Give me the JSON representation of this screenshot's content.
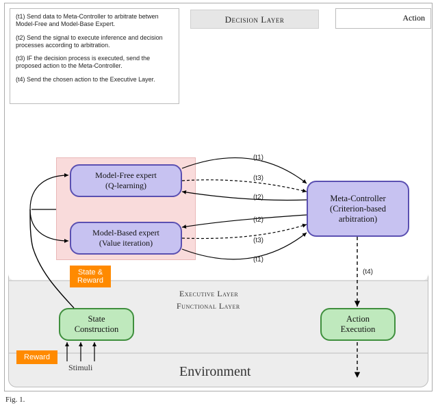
{
  "header": {
    "title": "Decision Layer",
    "action_label": "Action"
  },
  "legend": {
    "t1": "(t1) Send data to Meta-Controller to arbitrate betwen Model-Free and Model-Base Expert.",
    "t2": "(t2) Send the signal to execute inference and decision processes according to arbitration.",
    "t3": "(t3) IF the decision process is executed, send the proposed action to the Meta-Controller.",
    "t4": "(t4) Send the chosen action to the Executive Layer."
  },
  "experts": {
    "mf_line1": "Model-Free expert",
    "mf_line2": "(Q-learning)",
    "mb_line1": "Model-Based expert",
    "mb_line2": "(Value iteration)"
  },
  "meta": {
    "line1": "Meta-Controller",
    "line2": "(Criterion-based",
    "line3": "arbitration)"
  },
  "exec": {
    "state_line1": "State",
    "state_line2": "Construction",
    "action_line1": "Action",
    "action_line2": "Execution"
  },
  "tags": {
    "state_reward_l1": "State &",
    "state_reward_l2": "Reward",
    "reward": "Reward"
  },
  "layers": {
    "executive": "Executive Layer",
    "functional": "Functional Layer"
  },
  "env": "Environment",
  "stimuli": "Stimuli",
  "tmarks": {
    "t1": "(t1)",
    "t2": "(t2)",
    "t3": "(t3)",
    "t4": "(t4)"
  },
  "caption_prefix": "Fig. 1."
}
